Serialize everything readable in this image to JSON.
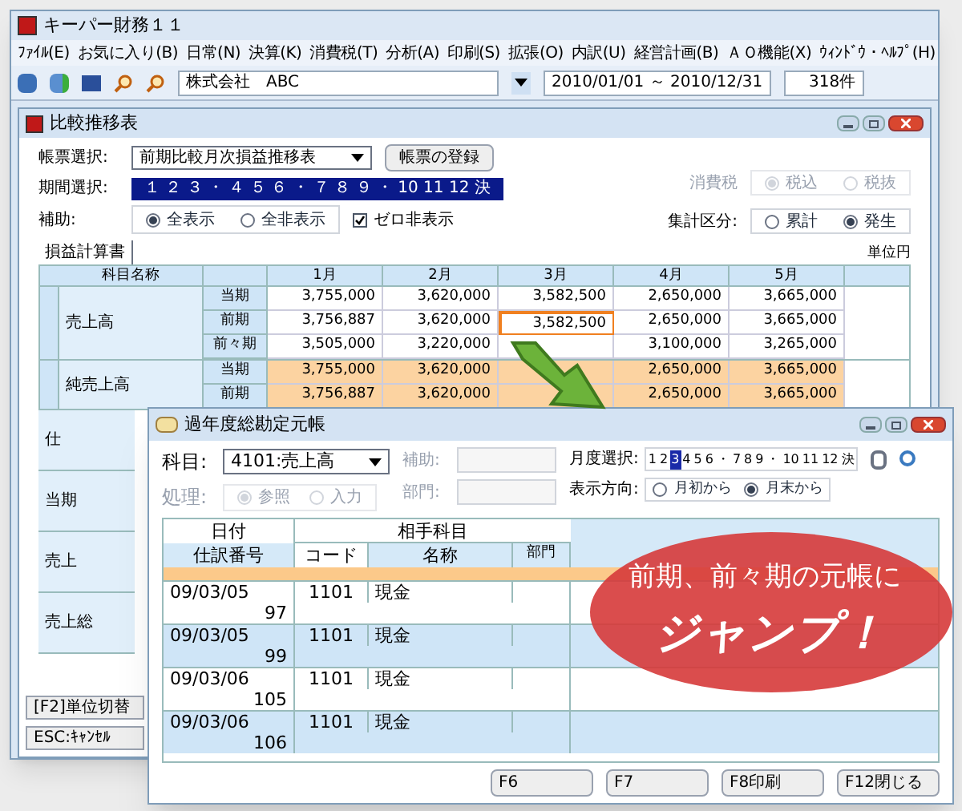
{
  "back_window": {
    "title": "キーパー財務１１",
    "menu": [
      "ﾌｧｲﾙ(E)",
      "お気に入り(B)",
      "日常(N)",
      "決算(K)",
      "消費税(T)",
      "分析(A)",
      "印刷(S)",
      "拡張(O)",
      "内訳(U)",
      "経営計画(B)",
      "ＡＯ機能(X)",
      "ｳｨﾝﾄﾞｳ・ﾍﾙﾌﾟ(H)"
    ],
    "toolbar": {
      "company": "株式会社　ABC",
      "period": "2010/01/01 ～ 2010/12/31",
      "count": "318件"
    },
    "report": {
      "title": "比較推移表",
      "report_select": {
        "label": "帳票選択:",
        "value": "前期比較月次損益推移表",
        "button": "帳票の登録"
      },
      "period_select": {
        "label": "期間選択:",
        "text": "１ ２ ３ ・ ４ ５ ６ ・ ７ ８ ９ ・ 10 11 12 決",
        "selected": true
      },
      "aux": {
        "label": "補助:",
        "options": [
          {
            "label": "全表示",
            "selected": true
          },
          {
            "label": "全非表示",
            "selected": false
          }
        ]
      },
      "zero_hide": {
        "label": "ゼロ非表示",
        "checked": true
      },
      "tax": {
        "label": "消費税",
        "disabled": true,
        "options": [
          {
            "label": "税込",
            "selected": true
          },
          {
            "label": "税抜",
            "selected": false
          }
        ]
      },
      "total": {
        "label": "集計区分:",
        "options": [
          {
            "label": "累計",
            "selected": false
          },
          {
            "label": "発生",
            "selected": true
          }
        ]
      },
      "tab": "損益計算書",
      "unit": "単位円",
      "table": {
        "columns": [
          "科目名称",
          "1月",
          "2月",
          "3月",
          "4月",
          "5月"
        ],
        "groups": [
          {
            "name": "売上高",
            "highlighted": false,
            "rows": [
              {
                "period": "当期",
                "cells": [
                  {
                    "text": "3,755,000",
                    "selected": false
                  },
                  {
                    "text": "3,620,000",
                    "selected": false
                  },
                  {
                    "text": "3,582,500",
                    "selected": false
                  },
                  {
                    "text": "2,650,000",
                    "selected": false
                  },
                  {
                    "text": "3,665,000",
                    "selected": false
                  }
                ]
              },
              {
                "period": "前期",
                "cells": [
                  {
                    "text": "3,756,887",
                    "selected": false
                  },
                  {
                    "text": "3,620,000",
                    "selected": false
                  },
                  {
                    "text": "3,582,500",
                    "selected": true
                  },
                  {
                    "text": "2,650,000",
                    "selected": false
                  },
                  {
                    "text": "3,665,000",
                    "selected": false
                  }
                ]
              },
              {
                "period": "前々期",
                "cells": [
                  {
                    "text": "3,505,000",
                    "selected": false
                  },
                  {
                    "text": "3,220,000",
                    "selected": false
                  },
                  null,
                  {
                    "text": "3,100,000",
                    "selected": false
                  },
                  {
                    "text": "3,265,000",
                    "selected": false
                  }
                ]
              }
            ]
          },
          {
            "name": "純売上高",
            "highlighted": true,
            "rows": [
              {
                "period": "当期",
                "cells": [
                  {
                    "text": "3,755,000",
                    "selected": false
                  },
                  {
                    "text": "3,620,000",
                    "selected": false
                  },
                  null,
                  {
                    "text": "2,650,000",
                    "selected": false
                  },
                  {
                    "text": "3,665,000",
                    "selected": false
                  }
                ]
              },
              {
                "period": "前期",
                "cells": [
                  {
                    "text": "3,756,887",
                    "selected": false
                  },
                  {
                    "text": "3,620,000",
                    "selected": false
                  },
                  null,
                  {
                    "text": "2,650,000",
                    "selected": false
                  },
                  {
                    "text": "3,665,000",
                    "selected": false
                  }
                ]
              }
            ]
          }
        ],
        "cut_labels": [
          "仕",
          "当期",
          "売上",
          "売上総"
        ]
      }
    },
    "footer": [
      "[F2]単位切替",
      "ESC:ｷｬﾝｾﾙ"
    ]
  },
  "ledger_window": {
    "title": "過年度総勘定元帳",
    "account": {
      "label": "科目:",
      "value": "4101:売上高"
    },
    "sub": {
      "label": "補助:",
      "disabled": true
    },
    "dept": {
      "label": "部門:",
      "disabled": true
    },
    "process": {
      "label": "処理:",
      "disabled": true,
      "options": [
        {
          "label": "参照",
          "selected": true
        },
        {
          "label": "入力",
          "selected": false
        }
      ]
    },
    "month_select": {
      "label": "月度選択:",
      "months": [
        {
          "label": "1",
          "selected": false
        },
        {
          "label": "2",
          "selected": false
        },
        {
          "label": "3",
          "selected": true
        },
        {
          "label": "4",
          "selected": false
        },
        {
          "label": "5",
          "selected": false
        },
        {
          "label": "6",
          "selected": false
        },
        {
          "label": "・",
          "selected": false
        },
        {
          "label": "7",
          "selected": false
        },
        {
          "label": "8",
          "selected": false
        },
        {
          "label": "9",
          "selected": false
        },
        {
          "label": "・",
          "selected": false
        },
        {
          "label": "10",
          "selected": false
        },
        {
          "label": "11",
          "selected": false
        },
        {
          "label": "12",
          "selected": false
        },
        {
          "label": "決",
          "selected": false
        }
      ]
    },
    "direction": {
      "label": "表示方向:",
      "options": [
        {
          "label": "月初から",
          "selected": false
        },
        {
          "label": "月末から",
          "selected": true
        }
      ]
    },
    "table": {
      "group_header": "相手科目",
      "columns": [
        "日付",
        "仕訳番号",
        "コード",
        "名称",
        "部門"
      ],
      "rows": [
        {
          "date": "09/03/05",
          "number": "97",
          "code": "1101",
          "name": "現金"
        },
        {
          "date": "09/03/05",
          "number": "99",
          "code": "1101",
          "name": "現金"
        },
        {
          "date": "09/03/06",
          "number": "105",
          "code": "1101",
          "name": "現金"
        },
        {
          "date": "09/03/06",
          "number": "106",
          "code": "1101",
          "name": "現金"
        }
      ]
    },
    "buttons": [
      "F6",
      "F7",
      "F8印刷",
      "F12閉じる"
    ]
  },
  "callout": {
    "line1": "前期、前々期の元帳に",
    "line2": "ジャンプ！"
  }
}
